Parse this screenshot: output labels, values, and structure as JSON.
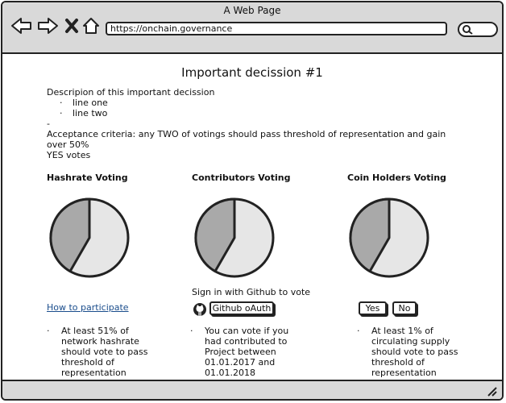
{
  "window": {
    "title": "A Web Page"
  },
  "browser": {
    "url": "https://onchain.governance"
  },
  "page": {
    "title": "Important decission #1",
    "description": "Descripion of this important decission",
    "items": [
      "line one",
      "line two"
    ],
    "dash": "-",
    "acceptance_line1": "Acceptance criteria: any TWO of votings should pass threshold of representation and gain over 50%",
    "acceptance_line2": "YES votes"
  },
  "columns": [
    {
      "title": "Hashrate Voting",
      "link": "How to participate",
      "note": [
        "At least 51% of",
        "network hashrate",
        "should vote to pass",
        "threshold of",
        "representation"
      ]
    },
    {
      "title": "Contributors Voting",
      "signin": "Sign in with Github to vote",
      "button": "Github oAuth",
      "note": [
        "You can vote if you",
        "had contributed to",
        "Project between",
        "01.01.2017 and",
        "01.01.2018"
      ]
    },
    {
      "title": "Coin Holders Voting",
      "yes": "Yes",
      "no": "No",
      "note": [
        "At least 1% of",
        "circulating supply",
        "should vote to pass",
        "threshold of",
        "representation"
      ]
    }
  ],
  "colors": {
    "pie_dark": "#a9a9a9",
    "pie_light": "#e6e6e6",
    "chrome": "#d9d9d9"
  }
}
